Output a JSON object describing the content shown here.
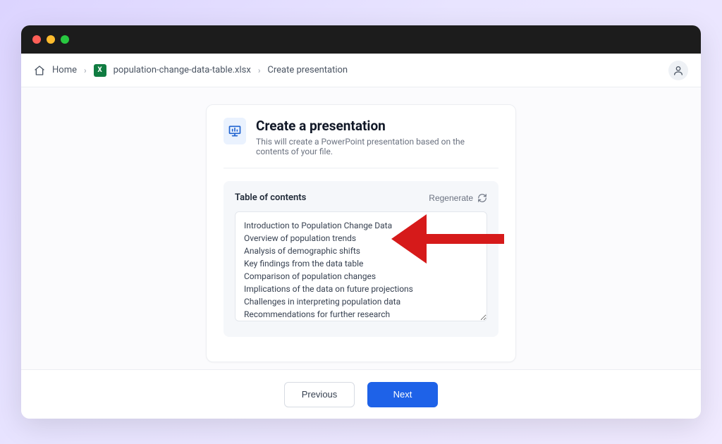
{
  "breadcrumbs": {
    "home": "Home",
    "file": "population-change-data-table.xlsx",
    "current": "Create presentation",
    "file_icon_letter": "X"
  },
  "card": {
    "title": "Create a presentation",
    "subtitle": "This will create a PowerPoint presentation based on the contents of your file."
  },
  "toc": {
    "label": "Table of contents",
    "regenerate": "Regenerate",
    "items": [
      "Introduction to Population Change Data",
      "Overview of population trends",
      "Analysis of demographic shifts",
      "Key findings from the data table",
      "Comparison of population changes",
      "Implications of the data on future projections",
      "Challenges in interpreting population data",
      "Recommendations for further research"
    ]
  },
  "footer": {
    "previous": "Previous",
    "next": "Next"
  },
  "colors": {
    "primary": "#1e62e8",
    "arrow": "#d61a1a"
  }
}
